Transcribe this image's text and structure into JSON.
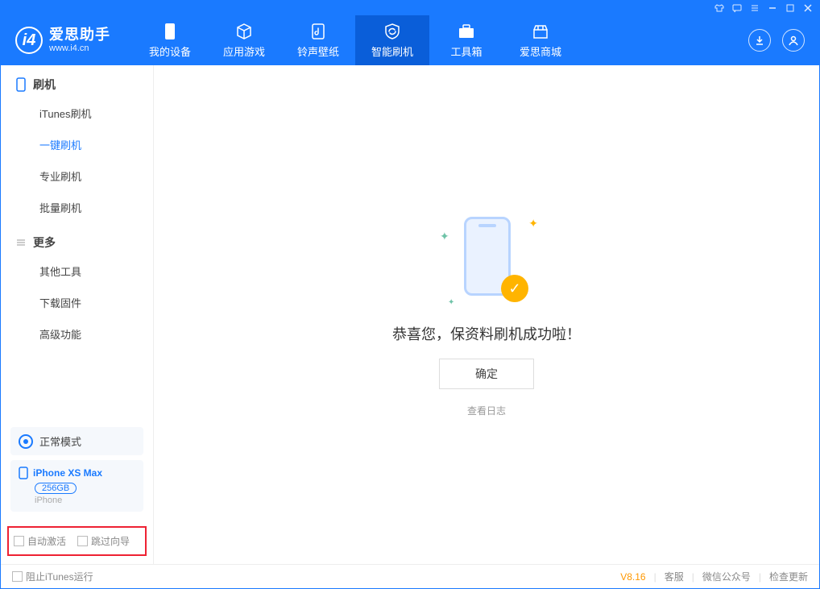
{
  "app": {
    "name": "爱思助手",
    "url": "www.i4.cn"
  },
  "tabs": [
    {
      "label": "我的设备"
    },
    {
      "label": "应用游戏"
    },
    {
      "label": "铃声壁纸"
    },
    {
      "label": "智能刷机"
    },
    {
      "label": "工具箱"
    },
    {
      "label": "爱思商城"
    }
  ],
  "sidebar": {
    "group1": "刷机",
    "items1": [
      {
        "label": "iTunes刷机"
      },
      {
        "label": "一键刷机"
      },
      {
        "label": "专业刷机"
      },
      {
        "label": "批量刷机"
      }
    ],
    "group2": "更多",
    "items2": [
      {
        "label": "其他工具"
      },
      {
        "label": "下载固件"
      },
      {
        "label": "高级功能"
      }
    ],
    "mode": "正常模式",
    "device": {
      "name": "iPhone XS Max",
      "capacity": "256GB",
      "type": "iPhone"
    },
    "checks": {
      "auto_activate": "自动激活",
      "skip_guide": "跳过向导"
    }
  },
  "main": {
    "message": "恭喜您，保资料刷机成功啦！",
    "ok": "确定",
    "view_log": "查看日志"
  },
  "footer": {
    "block_itunes": "阻止iTunes运行",
    "version": "V8.16",
    "links": {
      "service": "客服",
      "wechat": "微信公众号",
      "update": "检查更新"
    }
  }
}
